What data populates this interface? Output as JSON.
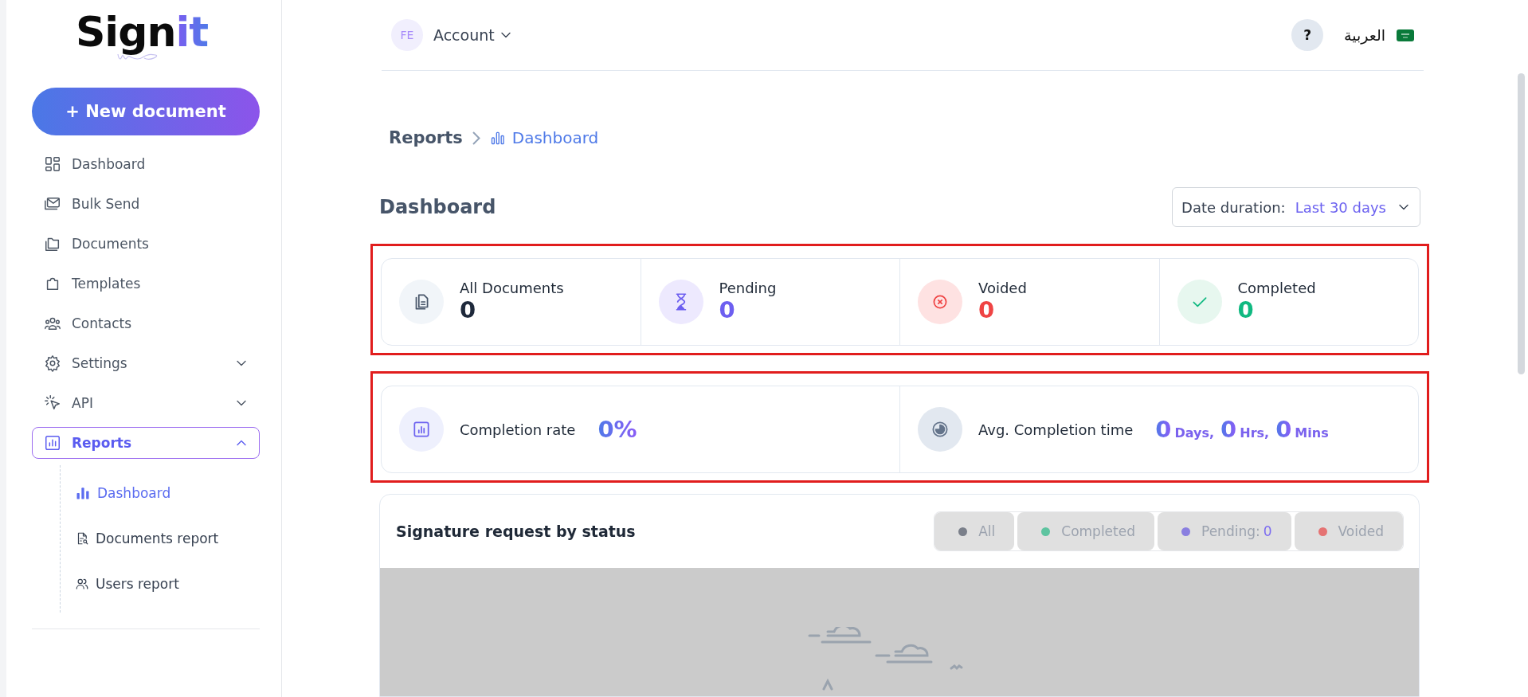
{
  "logo": {
    "text": "Sign",
    "accent": "it"
  },
  "new_document_button": "+ New document",
  "sidebar": {
    "items": [
      {
        "label": "Dashboard",
        "selected": false
      },
      {
        "label": "Bulk Send",
        "selected": false
      },
      {
        "label": "Documents",
        "selected": false
      },
      {
        "label": "Templates",
        "selected": false
      },
      {
        "label": "Contacts",
        "selected": false
      },
      {
        "label": "Settings",
        "selected": false,
        "expanded": false
      },
      {
        "label": "API",
        "selected": false,
        "expanded": false
      },
      {
        "label": "Reports",
        "selected": true,
        "expanded": true,
        "children": [
          {
            "label": "Dashboard",
            "selected": true
          },
          {
            "label": "Documents report",
            "selected": false
          },
          {
            "label": "Users report",
            "selected": false
          }
        ]
      }
    ]
  },
  "topbar": {
    "avatar": "FE",
    "account": "Account",
    "help": "?",
    "language": "العربية"
  },
  "breadcrumb": [
    {
      "label": "Reports"
    },
    {
      "label": "Dashboard"
    }
  ],
  "page_title": "Dashboard",
  "date_filter": {
    "label": "Date duration:",
    "value": "Last 30 days"
  },
  "stats": {
    "highlighted": true,
    "items": [
      {
        "label": "All Documents",
        "value": "0",
        "color": "#1e293b"
      },
      {
        "label": "Pending",
        "value": "0",
        "color": "#6d5ff0"
      },
      {
        "label": "Voided",
        "value": "0",
        "color": "#ef4444"
      },
      {
        "label": "Completed",
        "value": "0",
        "color": "#10b981"
      }
    ]
  },
  "metrics": {
    "highlighted": true,
    "items": [
      {
        "label": "Completion rate",
        "parts": [
          {
            "number": "0%"
          }
        ]
      },
      {
        "label": "Avg. Completion time",
        "parts": [
          {
            "number": "0",
            "unit": "Days,"
          },
          {
            "number": "0",
            "unit": "Hrs,"
          },
          {
            "number": "0",
            "unit": "Mins"
          }
        ]
      }
    ]
  },
  "chart": {
    "title": "Signature request by status",
    "filters": [
      {
        "label": "All",
        "color": "#7a7f8a"
      },
      {
        "label": "Completed",
        "color": "#5ec4a0"
      },
      {
        "label": "Pending:",
        "count": "0",
        "color": "#8a7fe0"
      },
      {
        "label": "Voided",
        "color": "#e57373"
      }
    ]
  }
}
